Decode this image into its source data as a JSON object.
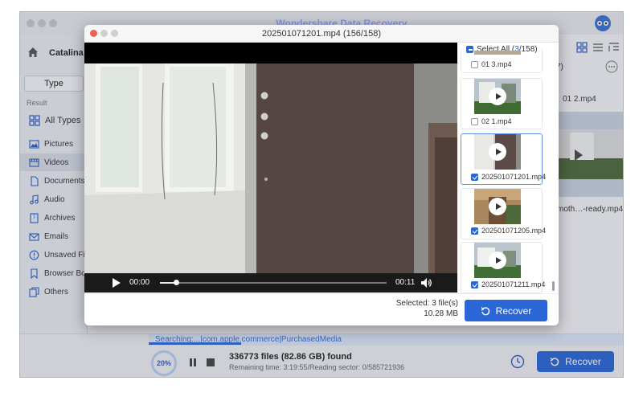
{
  "app": {
    "title": "Wondershare Data Recovery",
    "drive_label": "Catalina -",
    "type_button": "Type",
    "result_label": "Result"
  },
  "sidebar": {
    "items": [
      {
        "label": "All Types",
        "icon": "grid-icon"
      },
      {
        "label": "Pictures",
        "icon": "picture-icon"
      },
      {
        "label": "Videos",
        "icon": "video-icon",
        "active": true
      },
      {
        "label": "Documents",
        "icon": "document-icon"
      },
      {
        "label": "Audio",
        "icon": "music-icon"
      },
      {
        "label": "Archives",
        "icon": "archive-icon"
      },
      {
        "label": "Emails",
        "icon": "email-icon"
      },
      {
        "label": "Unsaved Files",
        "icon": "unsaved-icon"
      },
      {
        "label": "Browser Bookmarks",
        "icon": "bookmark-icon"
      },
      {
        "label": "Others",
        "icon": "others-icon"
      }
    ]
  },
  "background": {
    "count_fragment": "7)",
    "file_fragment_1": "01 2.mp4",
    "file_fragment_2": "moth…-ready.mp4"
  },
  "bottom": {
    "search_text": "Searching:...|com.apple.commerce|PurchasedMedia",
    "progress_percent": "20%",
    "found_text": "336773 files (82.86 GB) found",
    "remaining_text": "Remaining time: 3:19:55/Reading sector: 0/585721936",
    "recover_label": "Recover"
  },
  "preview": {
    "title": "202501071201.mp4 (156/158)",
    "current_time": "00:00",
    "duration": "00:11",
    "progress_fraction": 0.07,
    "select_all_label": "Select All (",
    "select_all_count": "3",
    "select_all_total": "/158)",
    "files": [
      {
        "name": "01 3.mp4",
        "checked": false,
        "selected": false
      },
      {
        "name": "02 1.mp4",
        "checked": false,
        "selected": false
      },
      {
        "name": "202501071201.mp4",
        "checked": true,
        "selected": true
      },
      {
        "name": "202501071205.mp4",
        "checked": true,
        "selected": false
      },
      {
        "name": "202501071211.mp4",
        "checked": true,
        "selected": false
      }
    ],
    "selected_summary": "Selected: 3 file(s)",
    "selected_size": "10.28 MB",
    "recover_label": "Recover"
  },
  "colors": {
    "accent": "#2a66d6",
    "sidebar_bg": "#e9ecf1",
    "active_item_bg": "#d6dbe4"
  }
}
